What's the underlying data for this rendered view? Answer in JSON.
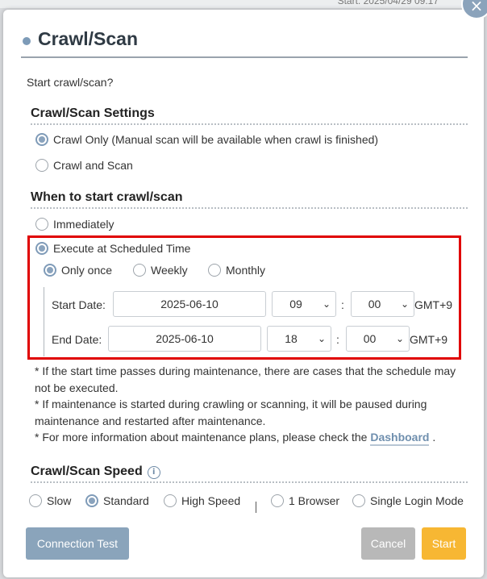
{
  "background": {
    "header_text": "Start: 2025/04/29 09:17"
  },
  "modal": {
    "close_icon": "×",
    "title": "Crawl/Scan",
    "intro": "Start crawl/scan?"
  },
  "settings": {
    "title": "Crawl/Scan Settings",
    "options": [
      {
        "label": "Crawl Only (Manual scan will be available when crawl is finished)",
        "checked": true
      },
      {
        "label": "Crawl and Scan",
        "checked": false
      }
    ]
  },
  "when": {
    "title": "When to start crawl/scan",
    "immediately": {
      "label": "Immediately",
      "checked": false
    },
    "scheduled": {
      "label": "Execute at Scheduled Time",
      "checked": true
    },
    "frequency": [
      {
        "label": "Only once",
        "checked": true
      },
      {
        "label": "Weekly",
        "checked": false
      },
      {
        "label": "Monthly",
        "checked": false
      }
    ],
    "start": {
      "label": "Start Date:",
      "date": "2025-06-10",
      "hour": "09",
      "minute": "00",
      "tz": "GMT+9"
    },
    "end": {
      "label": "End Date:",
      "date": "2025-06-10",
      "hour": "18",
      "minute": "00",
      "tz": "GMT+9"
    },
    "colon": ":"
  },
  "notes": {
    "line1": "* If the start time passes during maintenance, there are cases that the schedule may not be executed.",
    "line2": "* If maintenance is started during crawling or scanning, it will be paused during maintenance and restarted after maintenance.",
    "line3_prefix": "* For more information about maintenance plans, please check the ",
    "line3_link": "Dashboard",
    "line3_suffix": " ."
  },
  "speed": {
    "title": "Crawl/Scan Speed",
    "info_icon": "i",
    "options": [
      {
        "label": "Slow",
        "checked": false
      },
      {
        "label": "Standard",
        "checked": true
      },
      {
        "label": "High Speed",
        "checked": false
      }
    ],
    "browser_options": [
      {
        "label": "1 Browser",
        "checked": false
      },
      {
        "label": "Single Login Mode",
        "checked": false
      }
    ]
  },
  "buttons": {
    "connection_test": "Connection Test",
    "cancel": "Cancel",
    "start": "Start"
  },
  "colors": {
    "accent": "#8aa3bd",
    "highlight": "#e00000",
    "start_button": "#f7b733",
    "cancel_button": "#b8b8b8",
    "test_button": "#8aa4bb"
  }
}
